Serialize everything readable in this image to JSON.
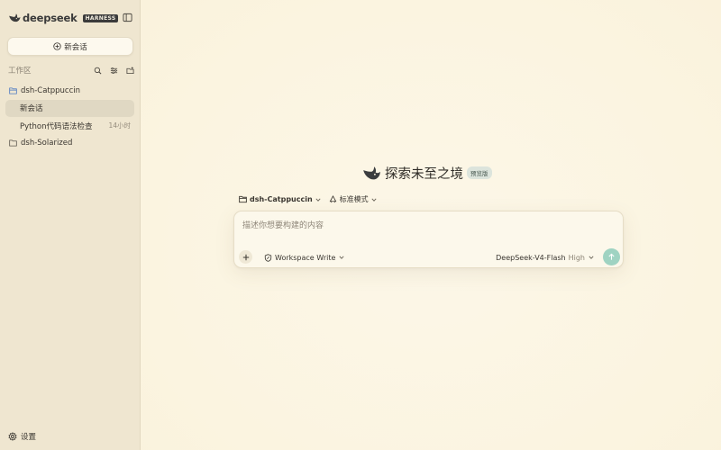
{
  "brand": {
    "name": "deepseek",
    "badge": "HARNESS"
  },
  "sidebar": {
    "new_chat_label": "新会话",
    "workspace_title": "工作区",
    "tree": [
      {
        "type": "folder",
        "label": "dsh-Catppuccin",
        "open": true
      },
      {
        "type": "session",
        "label": "新会话",
        "active": true
      },
      {
        "type": "session",
        "label": "Python代码语法检查",
        "time": "14小时"
      },
      {
        "type": "folder",
        "label": "dsh-Solarized",
        "open": false
      }
    ],
    "settings_label": "设置"
  },
  "hero": {
    "title": "探索未至之境",
    "badge": "预览版"
  },
  "context": {
    "workspace": "dsh-Catppuccin",
    "mode": "标准模式"
  },
  "composer": {
    "placeholder": "描述你想要构建的内容",
    "value": "",
    "permission": "Workspace Write",
    "model": "DeepSeek-V4-Flash",
    "effort": "High"
  },
  "colors": {
    "sidebar_bg": "#efe6d0",
    "main_bg": "#fbf5e3",
    "active_row": "#e0d8c3",
    "send_button": "#9fd3c2",
    "folder_open_icon": "#4a78c2"
  }
}
